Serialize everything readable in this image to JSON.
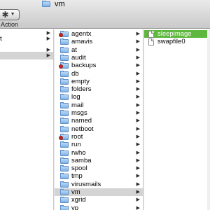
{
  "window": {
    "title": "vm",
    "title_icon": "folder-icon"
  },
  "toolbar": {
    "action_label": "Action",
    "action_icon": "gear-icon"
  },
  "column1": {
    "rows": [
      {
        "label": "",
        "has_arrow": true,
        "selected": false
      },
      {
        "label": "t",
        "has_arrow": true,
        "selected": false
      },
      {
        "label": "",
        "has_arrow": true,
        "selected": false
      },
      {
        "label": "",
        "has_arrow": true,
        "selected": true
      }
    ]
  },
  "column2": {
    "rows": [
      {
        "label": "agentx",
        "locked": true,
        "selected": false
      },
      {
        "label": "amavis",
        "locked": false,
        "selected": false
      },
      {
        "label": "at",
        "locked": false,
        "selected": false
      },
      {
        "label": "audit",
        "locked": false,
        "selected": false
      },
      {
        "label": "backups",
        "locked": true,
        "selected": false
      },
      {
        "label": "db",
        "locked": false,
        "selected": false
      },
      {
        "label": "empty",
        "locked": false,
        "selected": false
      },
      {
        "label": "folders",
        "locked": false,
        "selected": false
      },
      {
        "label": "log",
        "locked": false,
        "selected": false
      },
      {
        "label": "mail",
        "locked": false,
        "selected": false
      },
      {
        "label": "msgs",
        "locked": false,
        "selected": false
      },
      {
        "label": "named",
        "locked": false,
        "selected": false
      },
      {
        "label": "netboot",
        "locked": false,
        "selected": false
      },
      {
        "label": "root",
        "locked": true,
        "selected": false
      },
      {
        "label": "run",
        "locked": false,
        "selected": false
      },
      {
        "label": "rwho",
        "locked": false,
        "selected": false
      },
      {
        "label": "samba",
        "locked": false,
        "selected": false
      },
      {
        "label": "spool",
        "locked": false,
        "selected": false
      },
      {
        "label": "tmp",
        "locked": false,
        "selected": false
      },
      {
        "label": "virusmails",
        "locked": false,
        "selected": false
      },
      {
        "label": "vm",
        "locked": false,
        "selected": true
      },
      {
        "label": "xgrid",
        "locked": false,
        "selected": false
      },
      {
        "label": "yp",
        "locked": false,
        "selected": false
      }
    ]
  },
  "column3": {
    "rows": [
      {
        "label": "sleepimage",
        "selected": true
      },
      {
        "label": "swapfile0",
        "selected": false
      }
    ]
  },
  "colors": {
    "selection_green": "#5fb83e",
    "selection_gray": "#d4d4d4",
    "folder_blue": "#7fb1e6",
    "lock_red": "#c8281e"
  }
}
